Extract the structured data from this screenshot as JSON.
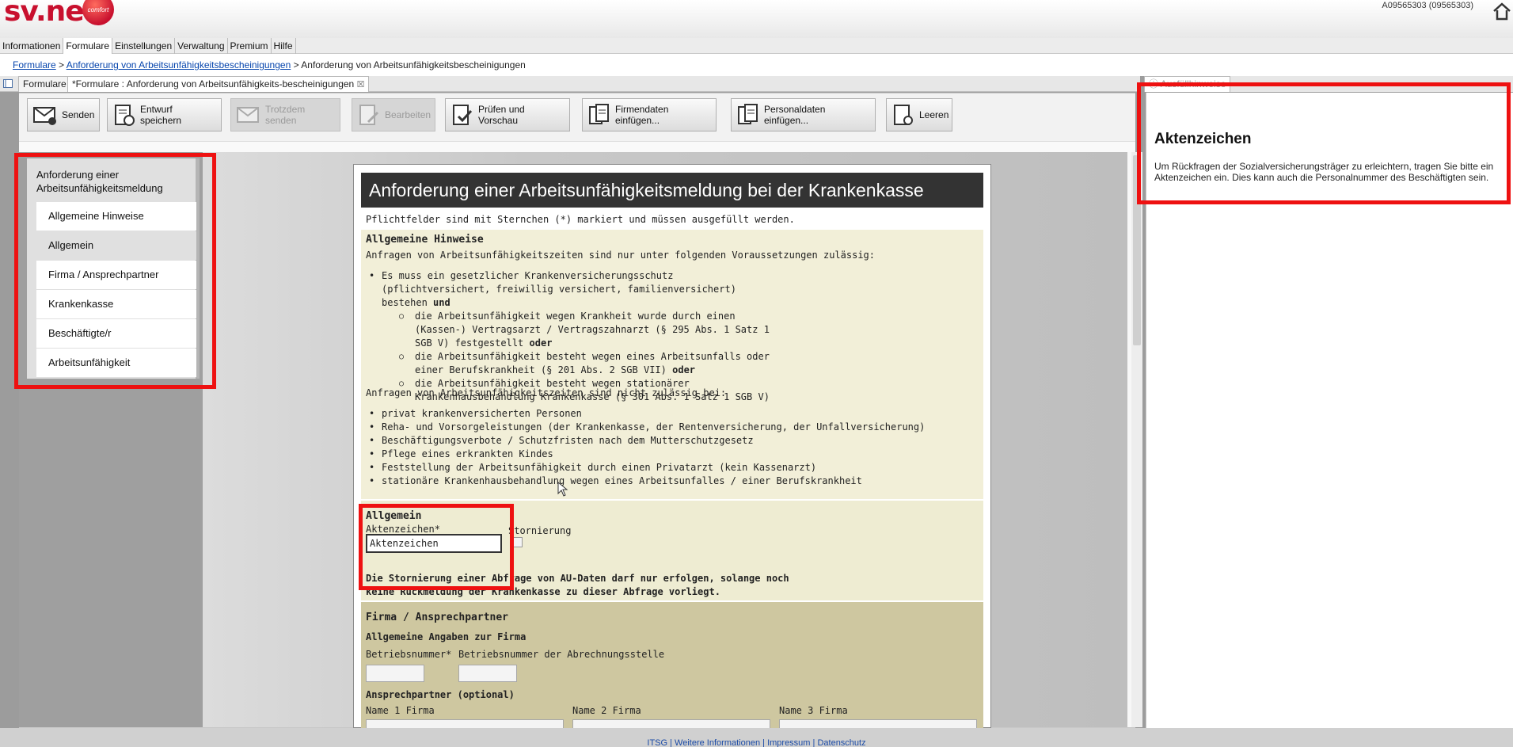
{
  "app": {
    "logo": "sv.net",
    "logo_badge": "comfort",
    "account": "A09565303 (09565303)"
  },
  "menu": [
    "Informationen",
    "Formulare",
    "Einstellungen",
    "Verwaltung",
    "Premium",
    "Hilfe"
  ],
  "breadcrumb": {
    "items": [
      "Formulare",
      "Anforderung von Arbeitsunfähigkeitsbescheinigungen",
      "Anforderung von Arbeitsunfähigkeitsbescheinigungen"
    ],
    "sep": " > "
  },
  "tabs": [
    "Formulare",
    "*Formulare : Anforderung von Arbeitsunfähigkeits-bescheinigungen"
  ],
  "right_tab": "Ausfüllhinweise",
  "toolbar": {
    "senden": "Senden",
    "entwurf": "Entwurf speichern",
    "trotzdem": "Trotzdem senden",
    "bearbeiten": "Bearbeiten",
    "pruefen": "Prüfen und Vorschau",
    "firmendaten": "Firmendaten einfügen...",
    "personaldaten": "Personaldaten einfügen...",
    "leeren": "Leeren"
  },
  "nav": {
    "title": "Anforderung einer Arbeitsunfähigkeitsmeldung",
    "items": [
      "Allgemeine Hinweise",
      "Allgemein",
      "Firma / Ansprechpartner",
      "Krankenkasse",
      "Beschäftigte/r",
      "Arbeitsunfähigkeit"
    ],
    "selected": "Allgemein"
  },
  "form": {
    "title": "Anforderung einer Arbeitsunfähigkeitsmeldung bei der Krankenkasse",
    "pflicht": "Pflichtfelder sind mit Sternchen (*) markiert und müssen ausgefüllt werden.",
    "hinweise_title": "Allgemeine Hinweise",
    "zulaessig_intro": "Anfragen von Arbeitsunfähigkeitszeiten sind nur unter folgenden Voraussetzungen zulässig:",
    "cond_1": "Es muss ein gesetzlicher Krankenversicherungsschutz (pflichtversichert, freiwillig versichert, familienversichert) bestehen",
    "und": "und",
    "oder": "oder",
    "sub_1": "die Arbeitsunfähigkeit wegen Krankheit wurde durch einen (Kassen-) Vertragsarzt / Vertragszahnarzt (§ 295 Abs. 1 Satz 1 SGB V) festgestellt",
    "sub_2": "die Arbeitsunfähigkeit besteht wegen eines Arbeitsunfalls oder einer Berufskrankheit (§ 201 Abs. 2 SGB VII)",
    "sub_3": "die Arbeitsunfähigkeit besteht wegen stationärer Krankenhausbehandlung Krankenkasse (§ 301 Abs. 1 Satz 1 SGB V)",
    "nicht_intro": "Anfragen von Arbeitsunfähigkeitszeiten sind nicht zulässig bei:",
    "nicht_items": [
      "privat krankenversicherten Personen",
      "Reha- und Vorsorgeleistungen (der Krankenkasse, der Rentenversicherung, der Unfallversicherung)",
      "Beschäftigungsverbote / Schutzfristen nach dem Mutterschutzgesetz",
      "Pflege eines erkrankten Kindes",
      "Feststellung der Arbeitsunfähigkeit durch einen Privatarzt (kein Kassenarzt)",
      "stationäre Krankenhausbehandlung wegen eines Arbeitsunfalles / einer Berufskrankheit"
    ],
    "allgemein_title": "Allgemein",
    "aktenzeichen_label": "Aktenzeichen*",
    "aktenzeichen_value": "Aktenzeichen",
    "stornierung_label": "Stornierung",
    "storno_note": "Die Stornierung einer Abfrage von AU-Daten darf nur erfolgen, solange noch keine Rückmeldung der Krankenkasse zu dieser Abfrage vorliegt.",
    "firma_title": "Firma / Ansprechpartner",
    "firma_sub": "Allgemeine Angaben zur Firma",
    "betriebsnummer": "Betriebsnummer*",
    "betriebsnummer_abr": "Betriebsnummer der Abrechnungsstelle",
    "ansprech_title": "Ansprechpartner (optional)",
    "name1": "Name 1 Firma",
    "name2": "Name 2 Firma",
    "name3": "Name 3 Firma"
  },
  "info": {
    "title": "Aktenzeichen",
    "text": "Um Rückfragen der Sozialversicherungsträger zu erleichtern, tragen Sie bitte ein Aktenzeichen ein. Dies kann auch die Personalnummer des Beschäftigten sein."
  },
  "footer": {
    "links": [
      "ITSG",
      "Weitere Informationen",
      "Impressum",
      "Datenschutz"
    ],
    "sep": "|"
  },
  "colors": {
    "brand_red": "#c8102e",
    "highlight_red": "#e11111",
    "form_header": "#333333",
    "info_band": "#f2efd8"
  }
}
